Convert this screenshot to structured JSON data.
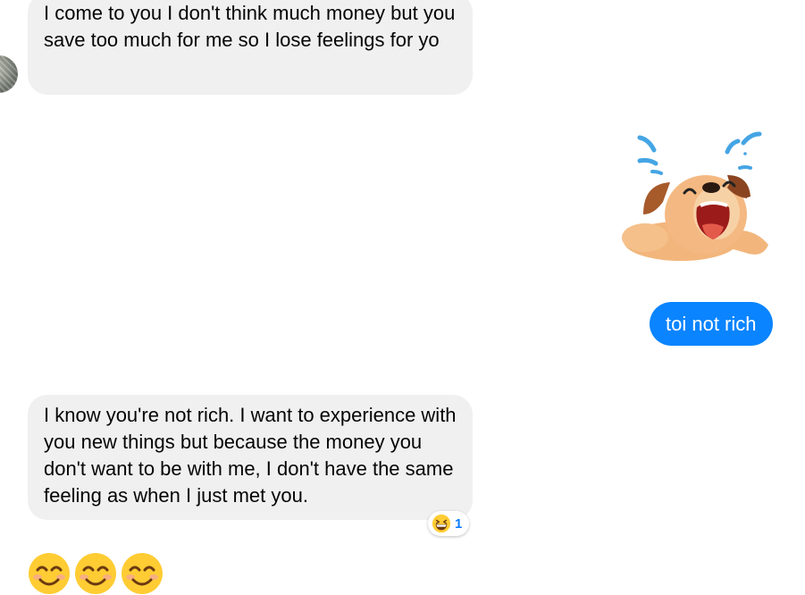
{
  "messages": [
    {
      "sender": "other",
      "text": "I come to you I don't think much money but you save too much for me so I lose feelings for yo"
    },
    {
      "sender": "me",
      "type": "sticker",
      "icon": "crying-dog-sticker"
    },
    {
      "sender": "me",
      "text": "toi not rich"
    },
    {
      "sender": "other",
      "text": "I know you're not rich. I want to experience with you new things but because the money you don't want to be with me, I don't have the same feeling as when I just met you.",
      "reaction": {
        "emoji": "grinning-squinting-face",
        "count": "1"
      }
    },
    {
      "sender": "other",
      "type": "emoji",
      "emojis": [
        "smiling-face-with-smiling-eyes",
        "smiling-face-with-smiling-eyes",
        "smiling-face-with-smiling-eyes"
      ]
    }
  ],
  "colors": {
    "incoming_bubble": "#f0f0f0",
    "outgoing_bubble": "#0a84ff",
    "reaction_count": "#0a7cff"
  }
}
